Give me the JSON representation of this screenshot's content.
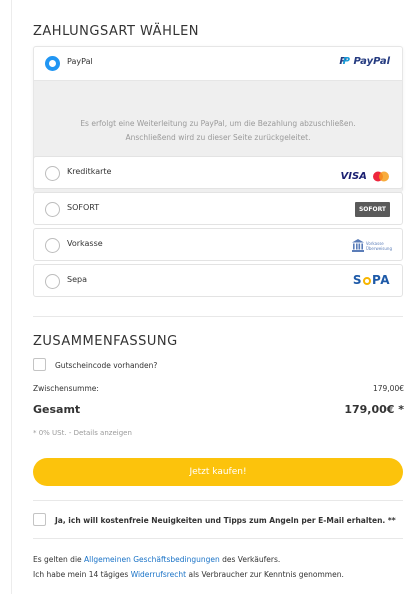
{
  "payment": {
    "title": "ZAHLUNGSART WÄHLEN",
    "methods": [
      {
        "label": "PayPal",
        "selected": true,
        "logo": "PayPal"
      },
      {
        "label": "Kreditkarte",
        "selected": false,
        "logo_visa": "VISA"
      },
      {
        "label": "SOFORT",
        "selected": false,
        "logo": "SOFORT"
      },
      {
        "label": "Vorkasse",
        "selected": false,
        "logo_line1": "Vorkasse",
        "logo_line2": "Überweisung"
      },
      {
        "label": "Sepa",
        "selected": false,
        "logo_s": "S",
        "logo_rest": "PA"
      }
    ],
    "paypal_note_1": "Es erfolgt eine Weiterleitung zu PayPal, um die Bezahlung abzuschließen.",
    "paypal_note_2": "Anschließend wird zu dieser Seite zurückgeleitet."
  },
  "summary": {
    "title": "ZUSAMMENFASSUNG",
    "voucher_label": "Gutscheincode vorhanden?",
    "subtotal_label": "Zwischensumme:",
    "subtotal_value": "179,00€",
    "total_label": "Gesamt",
    "total_value": "179,00€ *",
    "tax_note": "* 0% USt. - Details anzeigen"
  },
  "buy_button": "Jetzt kaufen!",
  "newsletter_label": "Ja, ich will kostenfreie Neuigkeiten und Tipps zum Angeln per E-Mail erhalten. **",
  "legal": {
    "line1_prefix": "Es gelten die ",
    "line1_link": "Allgemeinen Geschäftsbedingungen",
    "line1_suffix": " des Verkäufers.",
    "line2_prefix": "Ich habe mein 14 tägiges ",
    "line2_link": "Widerrufsrecht",
    "line2_suffix": " als Verbraucher zur Kenntnis genommen."
  },
  "colors": {
    "accent_blue": "#2196f3",
    "button_yellow": "#fcc30c",
    "link_blue": "#1a73c7"
  }
}
